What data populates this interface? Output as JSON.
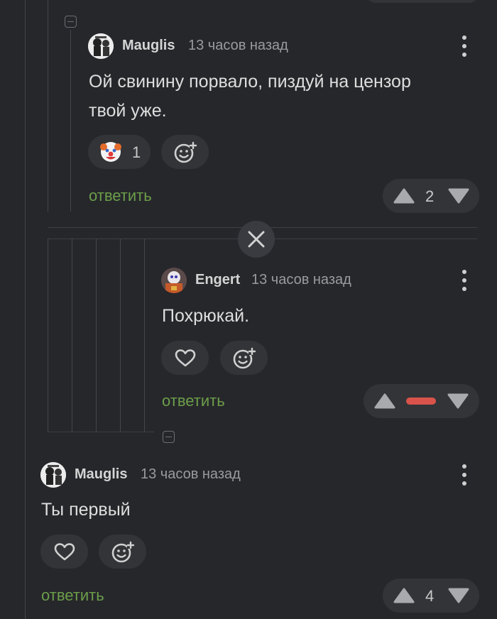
{
  "comments": [
    {
      "author": "Mauglis",
      "time": "13 часов назад",
      "text_line1": "Ой свинину порвало, пиздуй на цензор",
      "text_line2": "твой уже.",
      "reaction_icon": "clown-face-emoji",
      "reaction_count": "1",
      "reply_label": "ответить",
      "rating": "2"
    },
    {
      "author": "Engert",
      "time": "13 часов назад",
      "text": "Похрюкай.",
      "reply_label": "ответить",
      "rating_state": "hidden",
      "rating_bar_color": "#d9534a"
    },
    {
      "author": "Mauglis",
      "time": "13 часов назад",
      "text": "Ты первый",
      "reply_label": "ответить",
      "rating": "4"
    }
  ],
  "colors": {
    "background": "#26272b",
    "reply_link": "#6c9e4a",
    "pill": "#333438",
    "minus_bar": "#d9534a"
  },
  "icons": [
    "collapse-icon",
    "kebab-menu-icon",
    "add-reaction-icon",
    "heart-icon",
    "upvote-icon",
    "downvote-icon",
    "close-icon"
  ]
}
